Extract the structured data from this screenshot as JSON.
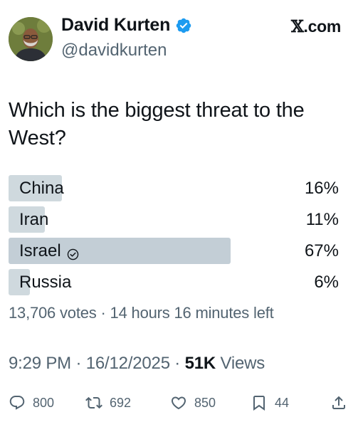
{
  "author": {
    "display_name": "David Kurten",
    "handle": "@davidkurten",
    "verified": true,
    "verified_color": "#1d9bf0"
  },
  "brand": {
    "mark": "𝕏",
    "suffix": ".com"
  },
  "post": {
    "text": "Which is the biggest threat to the West?"
  },
  "poll": {
    "options": [
      {
        "label": "China",
        "percent": "16%",
        "share": 16,
        "selected": false
      },
      {
        "label": "Iran",
        "percent": "11%",
        "share": 11,
        "selected": false
      },
      {
        "label": "Israel",
        "percent": "67%",
        "share": 67,
        "selected": true
      },
      {
        "label": "Russia",
        "percent": "6%",
        "share": 6,
        "selected": false
      }
    ],
    "votes": "13,706 votes",
    "separator": " · ",
    "time_left": "14 hours 16 minutes left"
  },
  "meta": {
    "time": "9:29 PM",
    "separator": " · ",
    "date": "16/12/2025",
    "views_count": "51K",
    "views_label": " Views"
  },
  "actions": {
    "replies": "800",
    "reposts": "692",
    "likes": "850",
    "bookmarks": "44"
  },
  "colors": {
    "text": "#0f1419",
    "secondary": "#536471",
    "poll_bar": "#cfd9de",
    "poll_bar_winner": "#c3ced6"
  }
}
